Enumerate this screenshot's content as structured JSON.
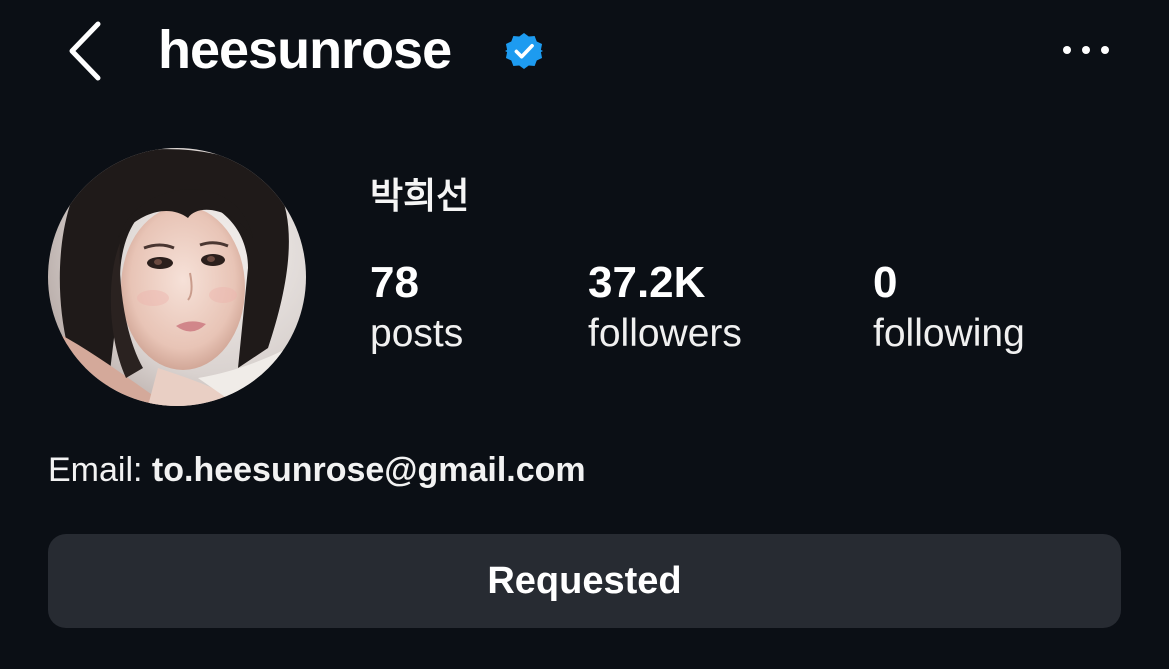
{
  "header": {
    "username": "heesunrose",
    "verified": true,
    "back_icon": "chevron-left-icon",
    "more_icon": "more-horizontal-icon"
  },
  "profile": {
    "display_name": "박희선",
    "avatar_icon": "profile-avatar",
    "stats": {
      "posts": {
        "value": "78",
        "label": "posts"
      },
      "followers": {
        "value": "37.2K",
        "label": "followers"
      },
      "following": {
        "value": "0",
        "label": "following"
      }
    },
    "bio": {
      "email_label": "Email:",
      "email_value": "to.heesunrose@gmail.com"
    }
  },
  "actions": {
    "follow_state_label": "Requested"
  },
  "colors": {
    "background": "#0b0f15",
    "button_bg": "#272b32",
    "verified_blue": "#1d9bf0",
    "text": "#ffffff"
  }
}
